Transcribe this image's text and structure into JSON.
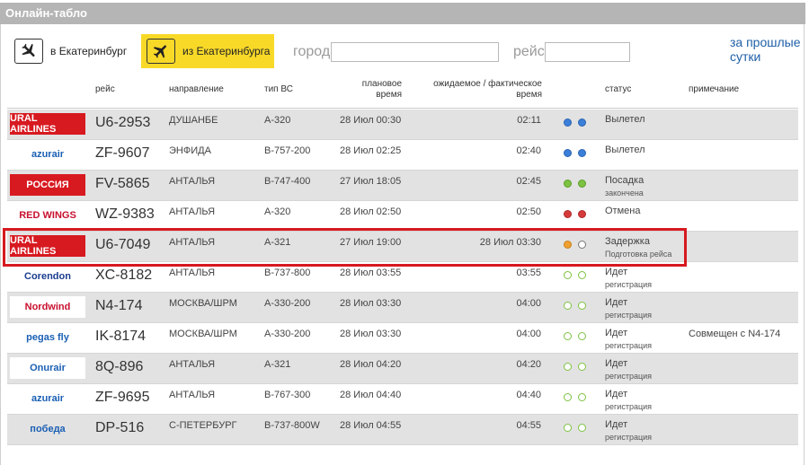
{
  "title": "Онлайн-табло",
  "tabs": [
    {
      "label": "в Екатеринбург",
      "active": false
    },
    {
      "label": "из Екатеринбурга",
      "active": true
    }
  ],
  "filters": {
    "city_label": "город",
    "city_value": "",
    "flight_label": "рейс",
    "flight_value": ""
  },
  "prev_day_link": "за прошлые сутки",
  "columns": {
    "flight": "рейс",
    "direction": "направление",
    "aircraft": "тип ВС",
    "planned": "плановое время",
    "actual": "ожидаемое / фактическое время",
    "status": "статус",
    "note": "примечание"
  },
  "colors": {
    "yellow": "#f8d928",
    "blue": "#3b7fd9",
    "green": "#7dc242",
    "red": "#d53b3b",
    "orange": "#f0a030",
    "highlight": "#d71920"
  },
  "flights": [
    {
      "airline": "URAL AIRLINES",
      "logo": "ural",
      "flight": "U6-2953",
      "direction": "ДУШАНБЕ",
      "aircraft": "A-320",
      "planned": "28 Июл 00:30",
      "actual": "02:11",
      "lights": [
        "blue",
        "blue"
      ],
      "status": "Вылетел",
      "status_sub": "",
      "note": ""
    },
    {
      "airline": "azurair",
      "logo": "azur",
      "flight": "ZF-9607",
      "direction": "ЭНФИДА",
      "aircraft": "B-757-200",
      "planned": "28 Июл 02:25",
      "actual": "02:40",
      "lights": [
        "blue",
        "blue"
      ],
      "status": "Вылетел",
      "status_sub": "",
      "note": ""
    },
    {
      "airline": "РОССИЯ",
      "logo": "rossiya",
      "flight": "FV-5865",
      "direction": "АНТАЛЬЯ",
      "aircraft": "B-747-400",
      "planned": "27 Июл 18:05",
      "actual": "02:45",
      "lights": [
        "green",
        "green"
      ],
      "status": "Посадка",
      "status_sub": "закончена",
      "note": ""
    },
    {
      "airline": "RED WINGS",
      "logo": "redwings",
      "flight": "WZ-9383",
      "direction": "АНТАЛЬЯ",
      "aircraft": "A-320",
      "planned": "28 Июл 02:50",
      "actual": "02:50",
      "lights": [
        "red",
        "red"
      ],
      "status": "Отмена",
      "status_sub": "",
      "note": ""
    },
    {
      "airline": "URAL AIRLINES",
      "logo": "ural",
      "flight": "U6-7049",
      "direction": "АНТАЛЬЯ",
      "aircraft": "A-321",
      "planned": "27 Июл 19:00",
      "actual": "28 Июл 03:30",
      "lights": [
        "orange",
        "empty"
      ],
      "status": "Задержка",
      "status_sub": "Подготовка рейса",
      "note": ""
    },
    {
      "airline": "Corendon",
      "logo": "corendon",
      "flight": "XC-8182",
      "direction": "АНТАЛЬЯ",
      "aircraft": "B-737-800",
      "planned": "28 Июл 03:55",
      "actual": "03:55",
      "lights": [
        "empty-green",
        "empty-green"
      ],
      "status": "Идет",
      "status_sub": "регистрация",
      "note": ""
    },
    {
      "airline": "Nordwind",
      "logo": "nordwind",
      "flight": "N4-174",
      "direction": "МОСКВА/ШРМ",
      "aircraft": "A-330-200",
      "planned": "28 Июл 03:30",
      "actual": "04:00",
      "lights": [
        "empty-green",
        "empty-green"
      ],
      "status": "Идет",
      "status_sub": "регистрация",
      "note": ""
    },
    {
      "airline": "pegas fly",
      "logo": "pegas",
      "flight": "IK-8174",
      "direction": "МОСКВА/ШРМ",
      "aircraft": "A-330-200",
      "planned": "28 Июл 03:30",
      "actual": "04:00",
      "lights": [
        "empty-green",
        "empty-green"
      ],
      "status": "Идет",
      "status_sub": "регистрация",
      "note": "Совмещен с N4-174"
    },
    {
      "airline": "Onurair",
      "logo": "onur",
      "flight": "8Q-896",
      "direction": "АНТАЛЬЯ",
      "aircraft": "A-321",
      "planned": "28 Июл 04:20",
      "actual": "04:20",
      "lights": [
        "empty-green",
        "empty-green"
      ],
      "status": "Идет",
      "status_sub": "регистрация",
      "note": ""
    },
    {
      "airline": "azurair",
      "logo": "azur",
      "flight": "ZF-9695",
      "direction": "АНТАЛЬЯ",
      "aircraft": "B-767-300",
      "planned": "28 Июл 04:40",
      "actual": "04:40",
      "lights": [
        "empty-green",
        "empty-green"
      ],
      "status": "Идет",
      "status_sub": "регистрация",
      "note": ""
    },
    {
      "airline": "победа",
      "logo": "pobeda",
      "flight": "DP-516",
      "direction": "С-ПЕТЕРБУРГ",
      "aircraft": "B-737-800W",
      "planned": "28 Июл 04:55",
      "actual": "04:55",
      "lights": [
        "empty-green",
        "empty-green"
      ],
      "status": "Идет",
      "status_sub": "регистрация",
      "note": ""
    }
  ]
}
